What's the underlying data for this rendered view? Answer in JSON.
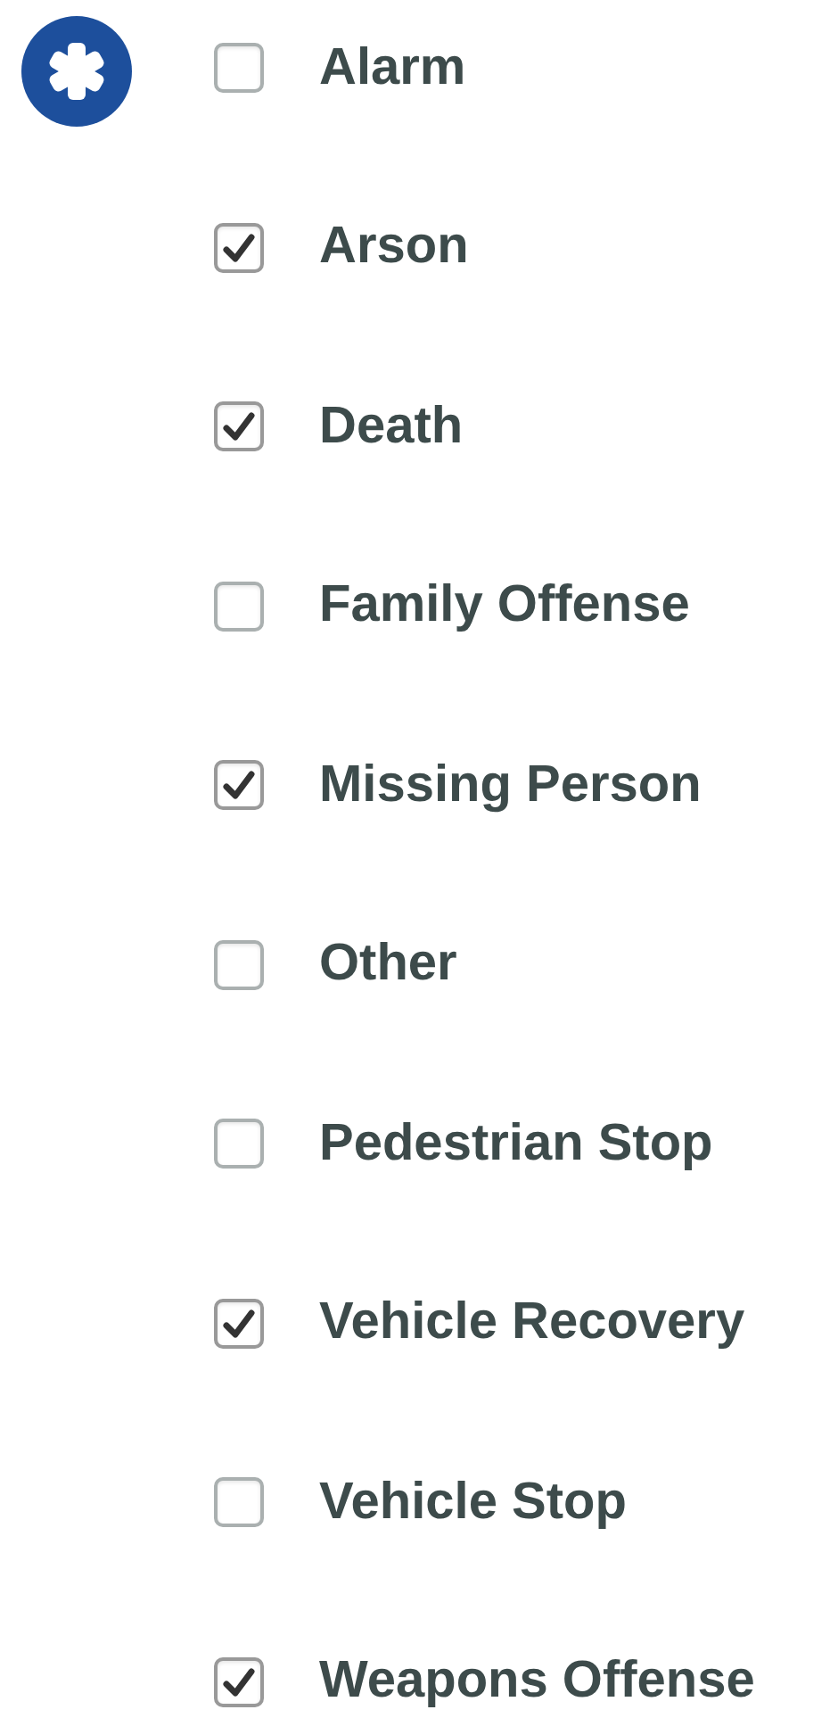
{
  "options": [
    {
      "label": "Alarm",
      "checked": false
    },
    {
      "label": "Arson",
      "checked": true
    },
    {
      "label": "Death",
      "checked": true
    },
    {
      "label": "Family Offense",
      "checked": false
    },
    {
      "label": "Missing Person",
      "checked": true
    },
    {
      "label": "Other",
      "checked": false
    },
    {
      "label": "Pedestrian Stop",
      "checked": false
    },
    {
      "label": "Vehicle Recovery",
      "checked": true
    },
    {
      "label": "Vehicle Stop",
      "checked": false
    },
    {
      "label": "Weapons Offense",
      "checked": true
    }
  ]
}
